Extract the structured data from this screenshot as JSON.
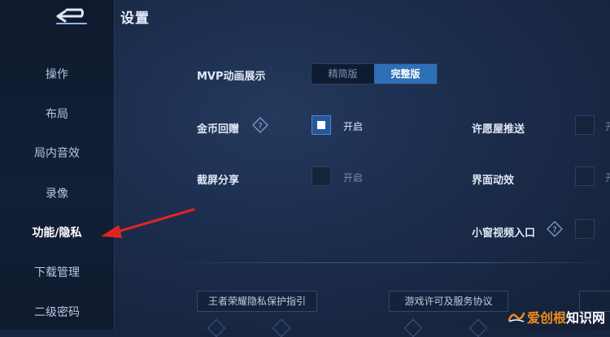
{
  "header": {
    "title": "设置"
  },
  "sidebar": {
    "items": [
      {
        "label": "操作"
      },
      {
        "label": "布局"
      },
      {
        "label": "局内音效"
      },
      {
        "label": "录像"
      },
      {
        "label": "功能/隐私"
      },
      {
        "label": "下载管理"
      },
      {
        "label": "二级密码"
      }
    ],
    "active": "功能/隐私"
  },
  "settings": {
    "mvp": {
      "label": "MVP动画展示",
      "options": [
        "精简版",
        "完整版"
      ],
      "selected": "完整版"
    },
    "coins": {
      "label": "金币回赠",
      "state": "开启",
      "checked": true
    },
    "screenshot": {
      "label": "截屏分享",
      "state": "开启",
      "checked": false
    },
    "wish": {
      "label": "许愿屋推送",
      "checked": false
    },
    "ui_anim": {
      "label": "界面动效",
      "checked": false
    },
    "mini_video": {
      "label": "小窗视频入口",
      "checked": false
    }
  },
  "links": {
    "privacy": "王者荣耀隐私保护指引",
    "license": "游戏许可及服务协议"
  },
  "watermark": {
    "part1": "爱创根",
    "part2": "知识网"
  },
  "colors": {
    "accent": "#2f6fb8",
    "arrow": "#e02424",
    "watermark_orange": "#f08a1c"
  }
}
